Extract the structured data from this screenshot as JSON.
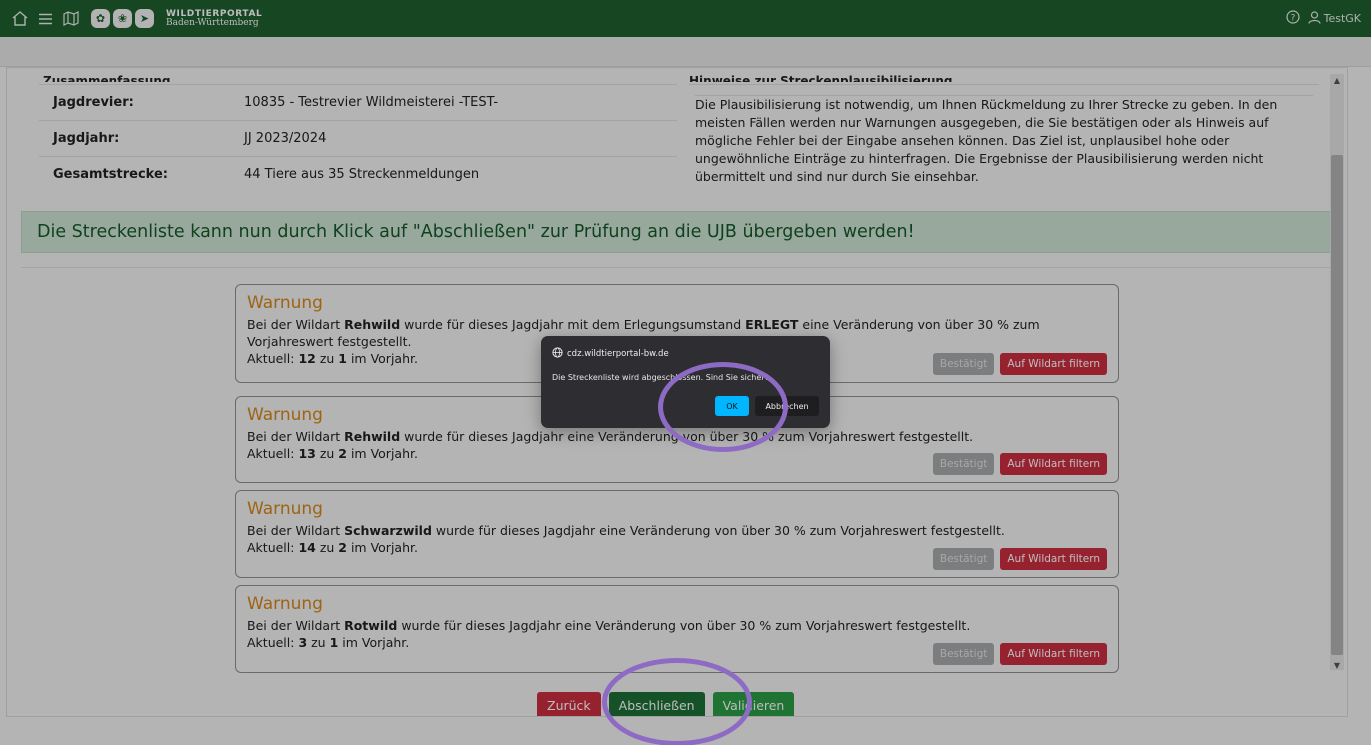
{
  "topbar": {
    "icons": [
      "home-icon",
      "menu-icon",
      "map-icon"
    ],
    "logo_badges": [
      "paw-icon",
      "hare-icon",
      "bird-icon"
    ],
    "brand_line1": "WILDTIERPORTAL",
    "brand_line2": "Baden-Württemberg",
    "help_icon": "help-circle-icon",
    "user_icon": "user-icon",
    "user_name": "TestGK"
  },
  "summary": {
    "header": "Zusammenfassung",
    "rows": [
      {
        "label": "Jagdrevier:",
        "value": "10835 - Testrevier Wildmeisterei -TEST-"
      },
      {
        "label": "Jagdjahr:",
        "value": "JJ 2023/2024"
      },
      {
        "label": "Gesamtstrecke:",
        "value": "44 Tiere aus 35 Streckenmeldungen"
      }
    ]
  },
  "hints": {
    "header": "Hinweise zur Streckenplausibilisierung",
    "text": "Die Plausibilisierung ist notwendig, um Ihnen Rückmeldung zu Ihrer Strecke zu geben. In den meisten Fällen werden nur Warnungen ausgegeben, die Sie bestätigen oder als Hinweis auf mögliche Fehler bei der Eingabe ansehen können. Das Ziel ist, unplausibel hohe oder ungewöhnliche Einträge zu hinterfragen. Die Ergebnisse der Plausibilisierung werden nicht übermittelt und sind nur durch Sie einsehbar."
  },
  "alert": {
    "text": "Die Streckenliste kann nun durch Klick auf \"Abschließen\" zur Prüfung an die UJB übergeben werden!"
  },
  "warnings": [
    {
      "title": "Warnung",
      "p1": "Bei der Wildart ",
      "species": "Rehwild",
      "p2": " wurde für dieses Jagdjahr mit dem Erlegungsumstand ",
      "circumstance": "ERLEGT",
      "p3": " eine Veränderung von über 30 % zum Vorjahreswert festgestellt.",
      "cur_prefix": "Aktuell: ",
      "current": "12",
      "cur_mid": " zu ",
      "previous": "1",
      "cur_suffix": " im Vorjahr.",
      "ack_label": "Bestätigt",
      "filter_label": "Auf Wildart filtern"
    },
    {
      "title": "Warnung",
      "p1": "Bei der Wildart ",
      "species": "Rehwild",
      "p2": " wurde für dieses Jagdjahr eine Veränderung von über 30 % zum Vorjahreswert festgestellt.",
      "cur_prefix": "Aktuell: ",
      "current": "13",
      "cur_mid": " zu ",
      "previous": "2",
      "cur_suffix": " im Vorjahr.",
      "ack_label": "Bestätigt",
      "filter_label": "Auf Wildart filtern"
    },
    {
      "title": "Warnung",
      "p1": "Bei der Wildart ",
      "species": "Schwarzwild",
      "p2": " wurde für dieses Jagdjahr eine Veränderung von über 30 % zum Vorjahreswert festgestellt.",
      "cur_prefix": "Aktuell: ",
      "current": "14",
      "cur_mid": " zu ",
      "previous": "2",
      "cur_suffix": " im Vorjahr.",
      "ack_label": "Bestätigt",
      "filter_label": "Auf Wildart filtern"
    },
    {
      "title": "Warnung",
      "p1": "Bei der Wildart ",
      "species": "Rotwild",
      "p2": " wurde für dieses Jagdjahr eine Veränderung von über 30 % zum Vorjahreswert festgestellt.",
      "cur_prefix": "Aktuell: ",
      "current": "3",
      "cur_mid": " zu ",
      "previous": "1",
      "cur_suffix": " im Vorjahr.",
      "ack_label": "Bestätigt",
      "filter_label": "Auf Wildart filtern"
    }
  ],
  "actions": {
    "back": "Zurück",
    "finish": "Abschließen",
    "validate": "Validieren"
  },
  "dialog": {
    "origin": "cdz.wildtierportal-bw.de",
    "origin_icon": "globe-icon",
    "message": "Die Streckenliste wird abgeschlossen. Sind Sie sicher?",
    "ok": "OK",
    "cancel": "Abbrechen"
  },
  "colors": {
    "topbar": "#1e5f2f",
    "alert_bg": "#cfe3d3",
    "warning_title": "#d6871a",
    "danger": "#cc2f40",
    "success_dark": "#1e6f35",
    "success": "#2a9c45",
    "dialog_ok": "#00b7ff",
    "annotation_ring": "#8d6bc5"
  }
}
